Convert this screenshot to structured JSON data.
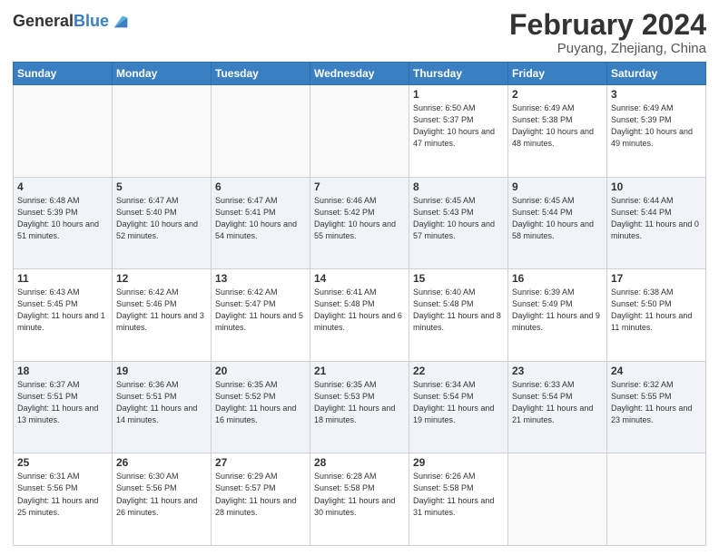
{
  "header": {
    "logo_general": "General",
    "logo_blue": "Blue",
    "month_year": "February 2024",
    "location": "Puyang, Zhejiang, China"
  },
  "days_of_week": [
    "Sunday",
    "Monday",
    "Tuesday",
    "Wednesday",
    "Thursday",
    "Friday",
    "Saturday"
  ],
  "weeks": [
    [
      {
        "day": "",
        "empty": true
      },
      {
        "day": "",
        "empty": true
      },
      {
        "day": "",
        "empty": true
      },
      {
        "day": "",
        "empty": true
      },
      {
        "day": "1",
        "sunrise": "6:50 AM",
        "sunset": "5:37 PM",
        "daylight": "10 hours and 47 minutes."
      },
      {
        "day": "2",
        "sunrise": "6:49 AM",
        "sunset": "5:38 PM",
        "daylight": "10 hours and 48 minutes."
      },
      {
        "day": "3",
        "sunrise": "6:49 AM",
        "sunset": "5:39 PM",
        "daylight": "10 hours and 49 minutes."
      }
    ],
    [
      {
        "day": "4",
        "sunrise": "6:48 AM",
        "sunset": "5:39 PM",
        "daylight": "10 hours and 51 minutes."
      },
      {
        "day": "5",
        "sunrise": "6:47 AM",
        "sunset": "5:40 PM",
        "daylight": "10 hours and 52 minutes."
      },
      {
        "day": "6",
        "sunrise": "6:47 AM",
        "sunset": "5:41 PM",
        "daylight": "10 hours and 54 minutes."
      },
      {
        "day": "7",
        "sunrise": "6:46 AM",
        "sunset": "5:42 PM",
        "daylight": "10 hours and 55 minutes."
      },
      {
        "day": "8",
        "sunrise": "6:45 AM",
        "sunset": "5:43 PM",
        "daylight": "10 hours and 57 minutes."
      },
      {
        "day": "9",
        "sunrise": "6:45 AM",
        "sunset": "5:44 PM",
        "daylight": "10 hours and 58 minutes."
      },
      {
        "day": "10",
        "sunrise": "6:44 AM",
        "sunset": "5:44 PM",
        "daylight": "11 hours and 0 minutes."
      }
    ],
    [
      {
        "day": "11",
        "sunrise": "6:43 AM",
        "sunset": "5:45 PM",
        "daylight": "11 hours and 1 minute."
      },
      {
        "day": "12",
        "sunrise": "6:42 AM",
        "sunset": "5:46 PM",
        "daylight": "11 hours and 3 minutes."
      },
      {
        "day": "13",
        "sunrise": "6:42 AM",
        "sunset": "5:47 PM",
        "daylight": "11 hours and 5 minutes."
      },
      {
        "day": "14",
        "sunrise": "6:41 AM",
        "sunset": "5:48 PM",
        "daylight": "11 hours and 6 minutes."
      },
      {
        "day": "15",
        "sunrise": "6:40 AM",
        "sunset": "5:48 PM",
        "daylight": "11 hours and 8 minutes."
      },
      {
        "day": "16",
        "sunrise": "6:39 AM",
        "sunset": "5:49 PM",
        "daylight": "11 hours and 9 minutes."
      },
      {
        "day": "17",
        "sunrise": "6:38 AM",
        "sunset": "5:50 PM",
        "daylight": "11 hours and 11 minutes."
      }
    ],
    [
      {
        "day": "18",
        "sunrise": "6:37 AM",
        "sunset": "5:51 PM",
        "daylight": "11 hours and 13 minutes."
      },
      {
        "day": "19",
        "sunrise": "6:36 AM",
        "sunset": "5:51 PM",
        "daylight": "11 hours and 14 minutes."
      },
      {
        "day": "20",
        "sunrise": "6:35 AM",
        "sunset": "5:52 PM",
        "daylight": "11 hours and 16 minutes."
      },
      {
        "day": "21",
        "sunrise": "6:35 AM",
        "sunset": "5:53 PM",
        "daylight": "11 hours and 18 minutes."
      },
      {
        "day": "22",
        "sunrise": "6:34 AM",
        "sunset": "5:54 PM",
        "daylight": "11 hours and 19 minutes."
      },
      {
        "day": "23",
        "sunrise": "6:33 AM",
        "sunset": "5:54 PM",
        "daylight": "11 hours and 21 minutes."
      },
      {
        "day": "24",
        "sunrise": "6:32 AM",
        "sunset": "5:55 PM",
        "daylight": "11 hours and 23 minutes."
      }
    ],
    [
      {
        "day": "25",
        "sunrise": "6:31 AM",
        "sunset": "5:56 PM",
        "daylight": "11 hours and 25 minutes."
      },
      {
        "day": "26",
        "sunrise": "6:30 AM",
        "sunset": "5:56 PM",
        "daylight": "11 hours and 26 minutes."
      },
      {
        "day": "27",
        "sunrise": "6:29 AM",
        "sunset": "5:57 PM",
        "daylight": "11 hours and 28 minutes."
      },
      {
        "day": "28",
        "sunrise": "6:28 AM",
        "sunset": "5:58 PM",
        "daylight": "11 hours and 30 minutes."
      },
      {
        "day": "29",
        "sunrise": "6:26 AM",
        "sunset": "5:58 PM",
        "daylight": "11 hours and 31 minutes."
      },
      {
        "day": "",
        "empty": true
      },
      {
        "day": "",
        "empty": true
      }
    ]
  ],
  "labels": {
    "sunrise": "Sunrise:",
    "sunset": "Sunset:",
    "daylight": "Daylight:"
  }
}
